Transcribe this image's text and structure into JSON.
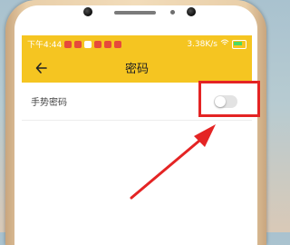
{
  "status_bar": {
    "time": "下午4:44",
    "speed": "3.38K/s"
  },
  "app_bar": {
    "title": "密码",
    "back_icon": "arrow-left-icon"
  },
  "settings": {
    "gesture_password_label": "手势密码",
    "gesture_password_enabled": false
  },
  "colors": {
    "accent": "#f5c521",
    "annotation": "#e42424"
  }
}
